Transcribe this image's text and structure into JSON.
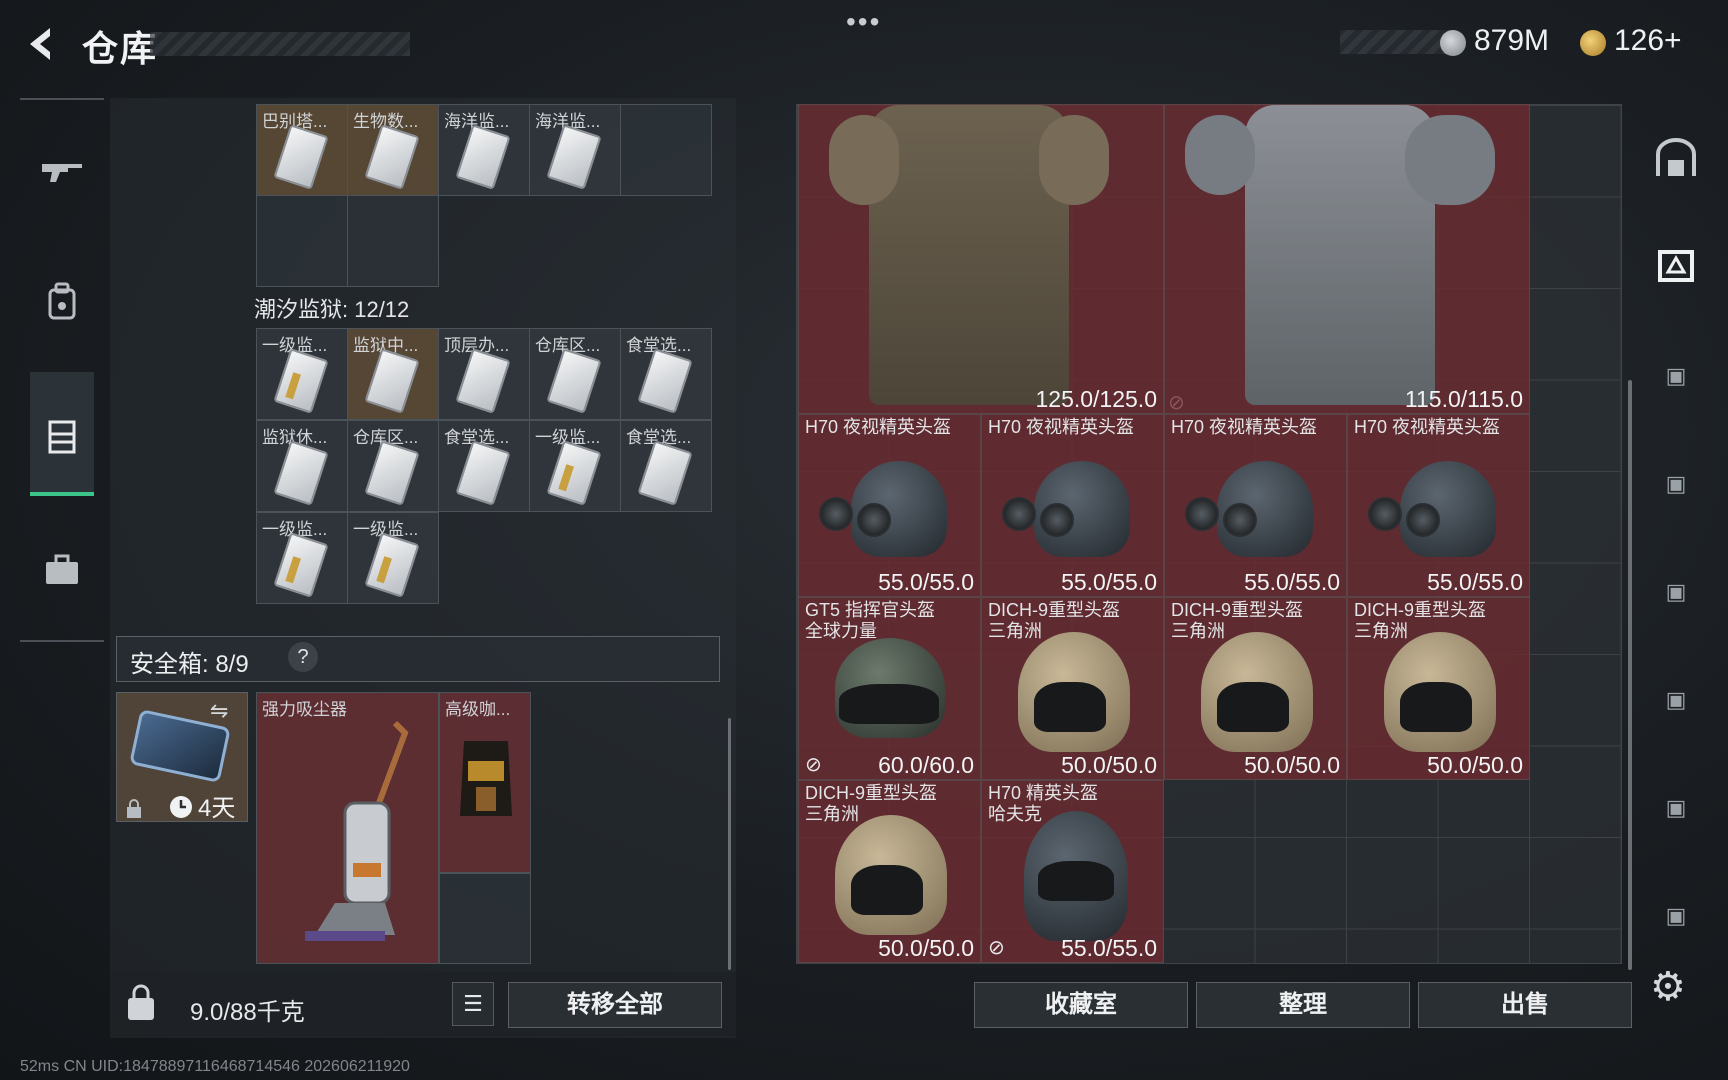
{
  "header": {
    "title": "仓库",
    "menu_dots": "•••",
    "money": "879M",
    "tokens": "126+"
  },
  "left_nav": [
    "rifle-icon",
    "backpack-icon",
    "vest-icon",
    "case-icon"
  ],
  "storage": {
    "top_row_labels": [
      "巴别塔...",
      "生物数...",
      "海洋监...",
      "海洋监..."
    ],
    "section_label": "潮汐监狱: 12/12",
    "prison_rows": [
      [
        "一级监...",
        "监狱中...",
        "顶层办...",
        "仓库区...",
        "食堂选..."
      ],
      [
        "监狱休...",
        "仓库区...",
        "食堂选...",
        "一级监...",
        "食堂选..."
      ],
      [
        "一级监...",
        "一级监..."
      ]
    ]
  },
  "safe": {
    "label": "安全箱: 8/9",
    "help": "?",
    "days": "4天",
    "items": [
      "强力吸尘器",
      "高级咖..."
    ]
  },
  "bottom_left": {
    "weight": "9.0/88千克",
    "transfer_all": "转移全部"
  },
  "grid_items": {
    "vest1_dur": "125.0/125.0",
    "vest2_dur": "115.0/115.0",
    "h70_name": "H70 夜视精英头盔",
    "h70_dur": "55.0/55.0",
    "gt5_name": "GT5 指挥官头盔",
    "gt5_sub": "全球力量",
    "gt5_dur": "60.0/60.0",
    "dich_name": "DICH-9重型头盔",
    "dich_sub": "三角洲",
    "dich_dur": "50.0/50.0",
    "h70e_name": "H70 精英头盔",
    "h70e_sub": "哈夫克",
    "h70e_dur": "55.0/55.0"
  },
  "bottom_right": {
    "collection": "收藏室",
    "organize": "整理",
    "sell": "出售"
  },
  "status": "52ms    CN UID:18478897116468714546 202606211920",
  "colors": {
    "item_red": "#6e2a30",
    "active_green": "#3cc48a",
    "gold_cell": "#685238"
  }
}
